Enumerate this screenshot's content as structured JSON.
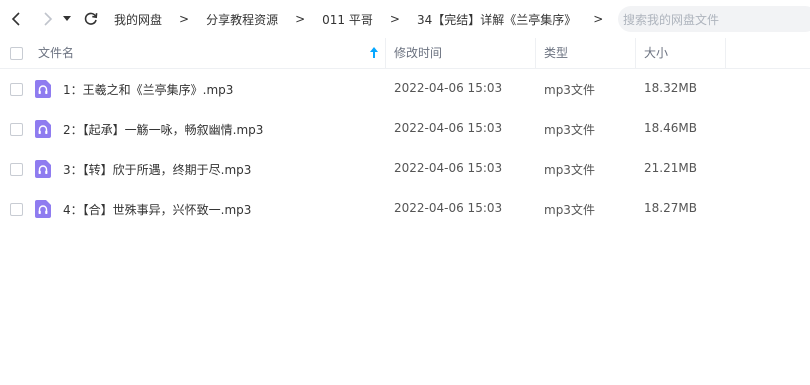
{
  "breadcrumb": [
    "我的网盘",
    "分享教程资源",
    "011 平哥",
    "34【完结】详解《兰亭集序》"
  ],
  "search": {
    "placeholder": "搜索我的网盘文件"
  },
  "columns": {
    "name": "文件名",
    "modified": "修改时间",
    "type": "类型",
    "size": "大小"
  },
  "files": [
    {
      "name": "1：王羲之和《兰亭集序》.mp3",
      "modified": "2022-04-06 15:03",
      "type": "mp3文件",
      "size": "18.32MB"
    },
    {
      "name": "2：【起承】一觞一咏，畅叙幽情.mp3",
      "modified": "2022-04-06 15:03",
      "type": "mp3文件",
      "size": "18.46MB"
    },
    {
      "name": "3：【转】欣于所遇，终期于尽.mp3",
      "modified": "2022-04-06 15:03",
      "type": "mp3文件",
      "size": "21.21MB"
    },
    {
      "name": "4：【合】世殊事异，兴怀致一.mp3",
      "modified": "2022-04-06 15:03",
      "type": "mp3文件",
      "size": "18.27MB"
    }
  ],
  "colors": {
    "accent": "#06a7ff",
    "audio_icon": "#8f7cf0"
  },
  "icons": [
    "back-arrow-icon",
    "forward-arrow-icon",
    "dropdown-caret-icon",
    "refresh-icon",
    "sort-ascending-icon",
    "audio-file-icon"
  ]
}
